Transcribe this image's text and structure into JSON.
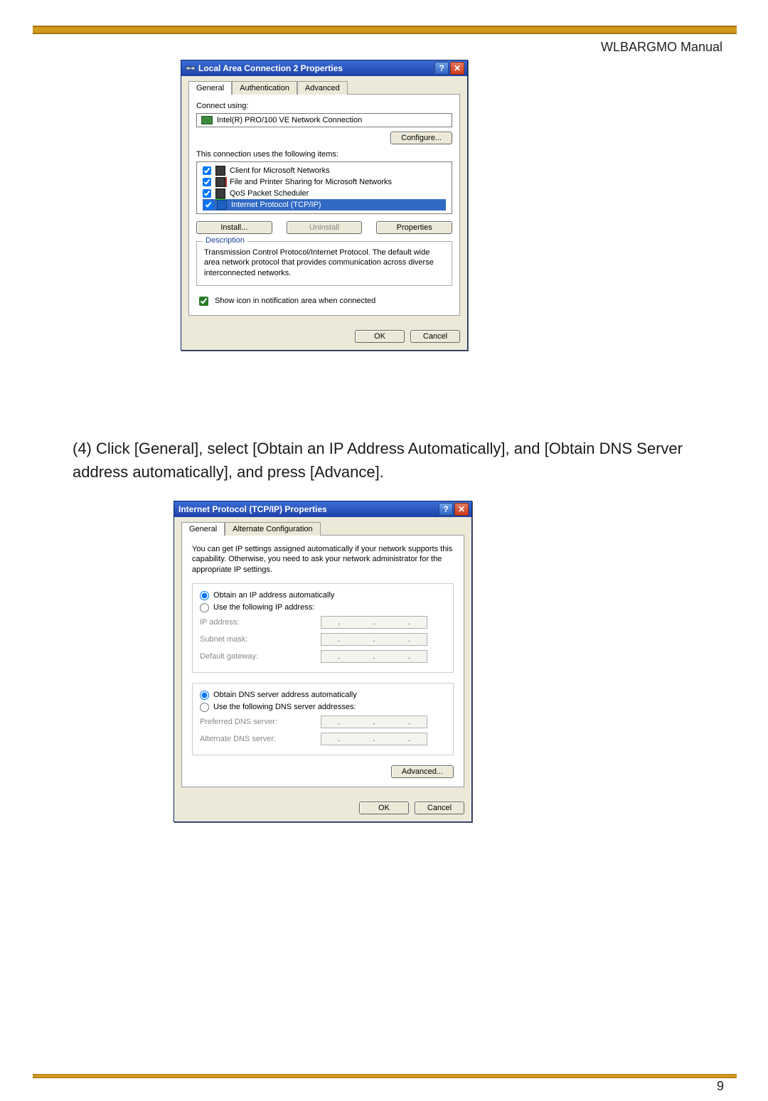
{
  "header": {
    "manual_title": "WLBARGMO Manual"
  },
  "dialog1": {
    "title": "Local Area Connection 2 Properties",
    "tabs": {
      "general": "General",
      "auth": "Authentication",
      "adv": "Advanced"
    },
    "connect_using_label": "Connect using:",
    "adapter": "Intel(R) PRO/100 VE Network Connection",
    "configure": "Configure...",
    "items_label": "This connection uses the following items:",
    "items": [
      {
        "label": "Client for Microsoft Networks"
      },
      {
        "label": "File and Printer Sharing for Microsoft Networks"
      },
      {
        "label": "QoS Packet Scheduler"
      },
      {
        "label": "Internet Protocol (TCP/IP)"
      }
    ],
    "install": "Install...",
    "uninstall": "Uninstall",
    "properties": "Properties",
    "desc_legend": "Description",
    "desc_text": "Transmission Control Protocol/Internet Protocol. The default wide area network protocol that provides communication across diverse interconnected networks.",
    "show_icon": "Show icon in notification area when connected",
    "ok": "OK",
    "cancel": "Cancel"
  },
  "instruction": "(4) Click [General], select [Obtain an IP Address Automatically], and [Obtain DNS Server address automatically], and press [Advance].",
  "dialog2": {
    "title": "Internet Protocol (TCP/IP) Properties",
    "tabs": {
      "general": "General",
      "alt": "Alternate Configuration"
    },
    "intro": "You can get IP settings assigned automatically if your network supports this capability. Otherwise, you need to ask your network administrator for the appropriate IP settings.",
    "radio_auto_ip": "Obtain an IP address automatically",
    "radio_use_ip": "Use the following IP address:",
    "lbl_ip": "IP address:",
    "lbl_mask": "Subnet mask:",
    "lbl_gw": "Default gateway:",
    "radio_auto_dns": "Obtain DNS server address automatically",
    "radio_use_dns": "Use the following DNS server addresses:",
    "lbl_pref": "Preferred DNS server:",
    "lbl_alt": "Alternate DNS server:",
    "advanced": "Advanced...",
    "ok": "OK",
    "cancel": "Cancel"
  },
  "page_number": "9"
}
